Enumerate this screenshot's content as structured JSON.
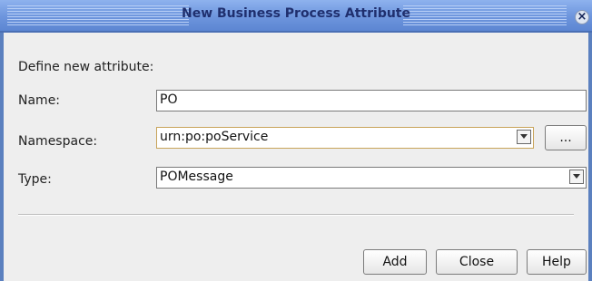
{
  "dialog": {
    "title": "New Business Process Attribute"
  },
  "form": {
    "header": "Define new attribute:",
    "name_label": "Name:",
    "name_value": "PO",
    "namespace_label": "Namespace:",
    "namespace_value": "urn:po:poService",
    "namespace_browse_label": "...",
    "type_label": "Type:",
    "type_value": "POMessage"
  },
  "buttons": {
    "add": "Add",
    "close": "Close",
    "help": "Help"
  },
  "icons": {
    "close": "close-icon",
    "dropdown": "chevron-down-icon"
  },
  "colors": {
    "title_bar": "#6f97de",
    "title_text": "#1f2f6e",
    "focus_border": "#c8a45a"
  }
}
